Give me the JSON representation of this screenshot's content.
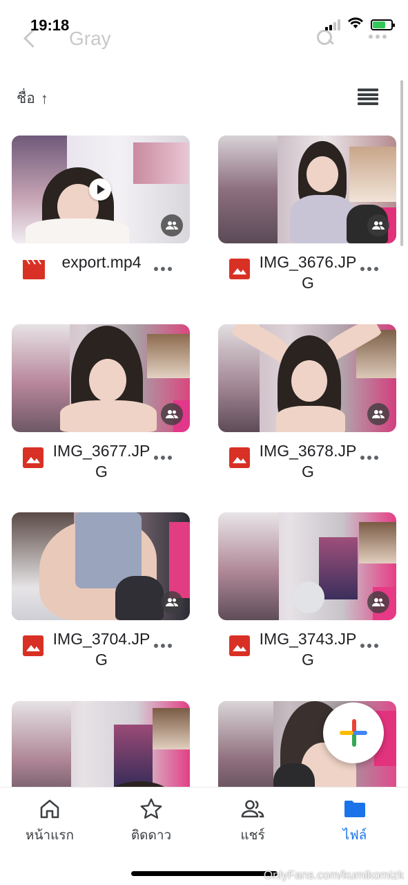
{
  "status_bar": {
    "time": "19:18",
    "battery_level": 0.7
  },
  "header": {
    "folder_title": "Gray"
  },
  "sort": {
    "label": "ชื่อ",
    "arrow": "↑"
  },
  "files": [
    {
      "name": "export.mp4",
      "type": "video",
      "shared": true
    },
    {
      "name": "IMG_3676.JPG",
      "type": "image",
      "shared": true
    },
    {
      "name": "IMG_3677.JPG",
      "type": "image",
      "shared": true
    },
    {
      "name": "IMG_3678.JPG",
      "type": "image",
      "shared": true
    },
    {
      "name": "IMG_3704.JPG",
      "type": "image",
      "shared": true
    },
    {
      "name": "IMG_3743.JPG",
      "type": "image",
      "shared": true
    },
    {
      "type": "image",
      "shared": false
    },
    {
      "type": "image",
      "shared": false
    }
  ],
  "bottom_nav": {
    "items": [
      {
        "label": "หน้าแรก",
        "icon": "home-icon",
        "active": false
      },
      {
        "label": "ติดดาว",
        "icon": "star-icon",
        "active": false
      },
      {
        "label": "แชร์",
        "icon": "people-icon",
        "active": false
      },
      {
        "label": "ไฟล์",
        "icon": "folder-icon",
        "active": true
      }
    ]
  },
  "watermark": "OnlyFans.com/kumikomizk",
  "colors": {
    "accent": "#1a73e8",
    "file_icon_red": "#d93025",
    "fab_blue": "#4285f4",
    "fab_red": "#ea4335",
    "fab_yellow": "#fbbc04",
    "fab_green": "#34a853"
  }
}
